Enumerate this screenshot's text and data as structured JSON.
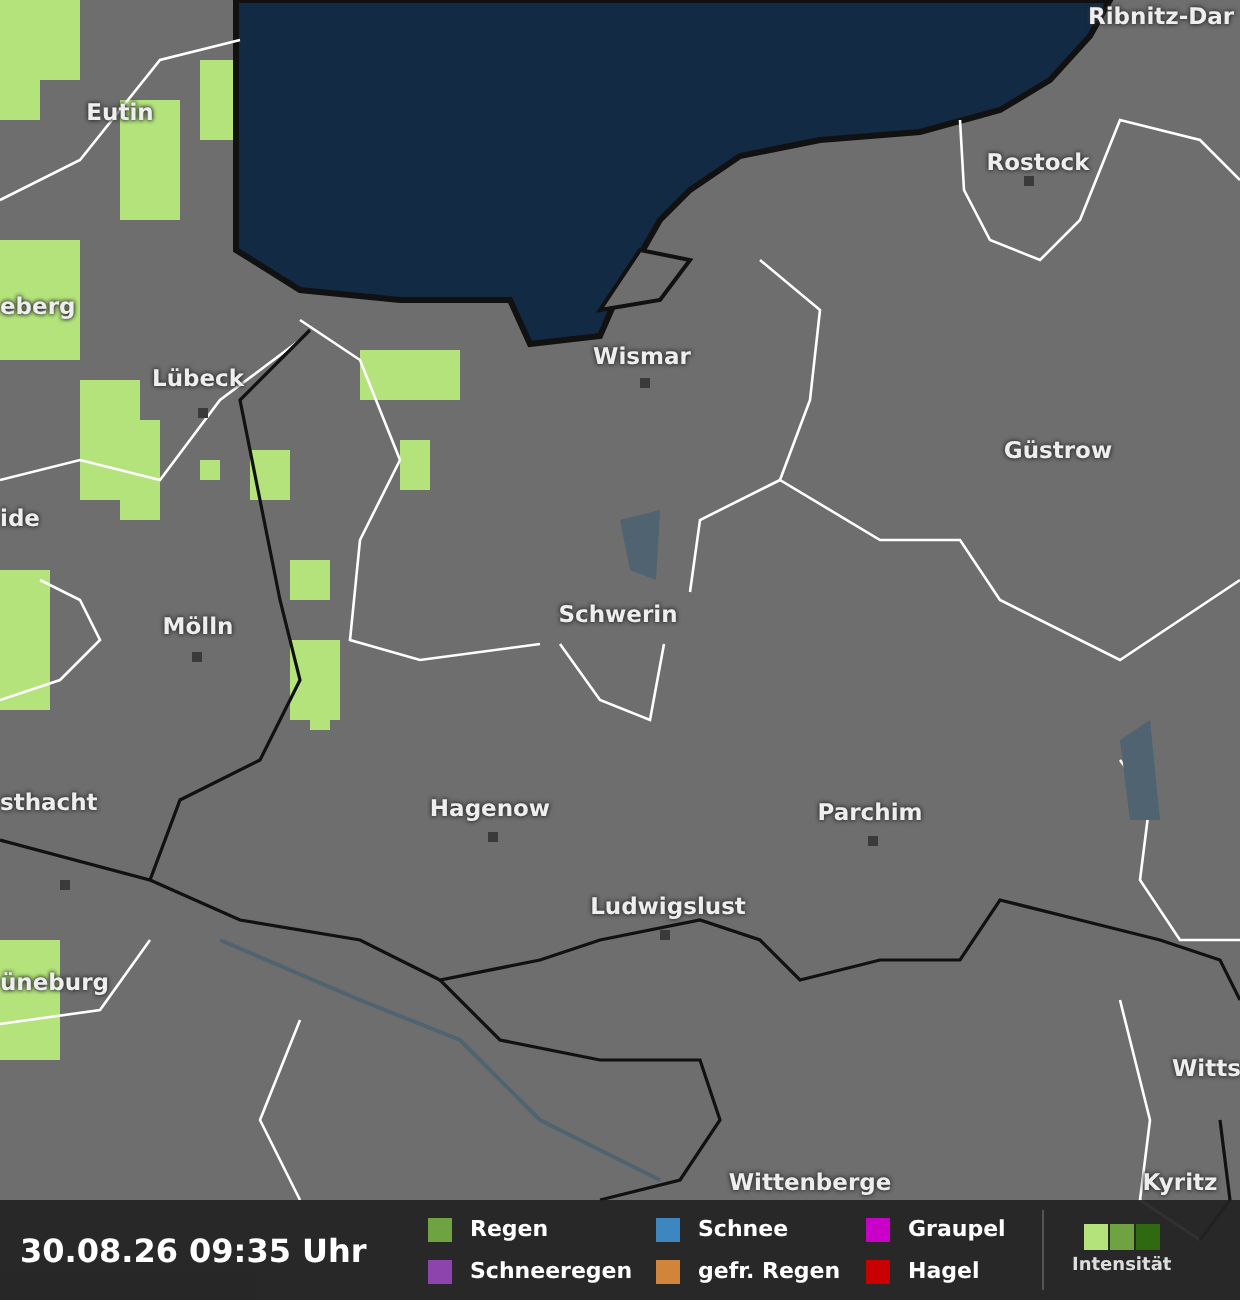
{
  "map": {
    "cities": [
      {
        "name": "Ribnitz-Dar"
      },
      {
        "name": "Eutin"
      },
      {
        "name": "Rostock"
      },
      {
        "name": "eberg"
      },
      {
        "name": "Lübeck"
      },
      {
        "name": "Wismar"
      },
      {
        "name": "Güstrow"
      },
      {
        "name": "ide"
      },
      {
        "name": "Mölln"
      },
      {
        "name": "Schwerin"
      },
      {
        "name": "sthacht"
      },
      {
        "name": "Hagenow"
      },
      {
        "name": "Parchim"
      },
      {
        "name": "Ludwigslust"
      },
      {
        "name": "üneburg"
      },
      {
        "name": "Witts"
      },
      {
        "name": "Wittenberge"
      },
      {
        "name": "Kyritz"
      }
    ]
  },
  "footer": {
    "timestamp": "30.08.26 09:35 Uhr",
    "legend": [
      {
        "label": "Regen",
        "color": "#6fa341"
      },
      {
        "label": "Schneeregen",
        "color": "#8e44ad"
      },
      {
        "label": "Schnee",
        "color": "#3e86c0"
      },
      {
        "label": "gefr. Regen",
        "color": "#d2843a"
      },
      {
        "label": "Graupel",
        "color": "#c800c8"
      },
      {
        "label": "Hagel",
        "color": "#c80000"
      }
    ],
    "intensity_label": "Intensität"
  }
}
